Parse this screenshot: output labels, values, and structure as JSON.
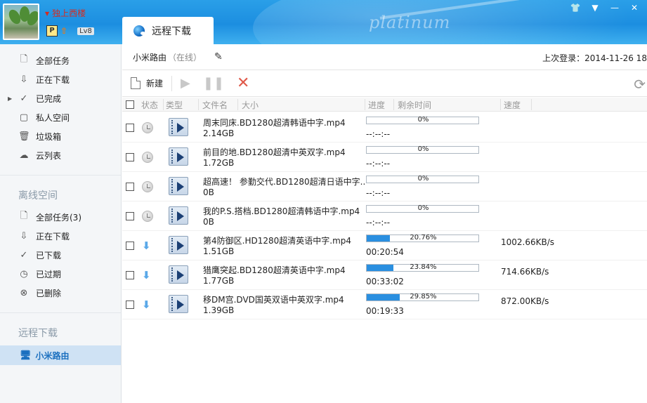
{
  "header": {
    "username": "独上西楼",
    "level": "Lv8",
    "vip": "P",
    "watermark": "platinum",
    "tab_label": "远程下载"
  },
  "sidebar": {
    "group1": [
      {
        "label": "全部任务",
        "icon": "doc-icon"
      },
      {
        "label": "正在下载",
        "icon": "download-arrow-icon"
      },
      {
        "label": "已完成",
        "icon": "check-icon"
      },
      {
        "label": "私人空间",
        "icon": "private-space-icon"
      },
      {
        "label": "垃圾箱",
        "icon": "trash-icon"
      },
      {
        "label": "云列表",
        "icon": "cloud-icon"
      }
    ],
    "offline_title": "离线空间",
    "group2": [
      {
        "label": "全部任务(3)",
        "icon": "doc-icon"
      },
      {
        "label": "正在下载",
        "icon": "download-arrow-icon"
      },
      {
        "label": "已下载",
        "icon": "check-icon"
      },
      {
        "label": "已过期",
        "icon": "clock-icon"
      },
      {
        "label": "已删除",
        "icon": "x-circle-icon"
      }
    ],
    "remote_title": "远程下载",
    "active_item": "小米路由"
  },
  "device": {
    "name": "小米路由",
    "status": "（在线）",
    "last_login": "上次登录：2014-11-26 18:"
  },
  "toolbar": {
    "new_label": "新建"
  },
  "columns": {
    "status": "状态",
    "type": "类型",
    "filename": "文件名",
    "size": "大小",
    "progress": "进度",
    "remaining": "剩余时间",
    "speed": "速度"
  },
  "tasks": [
    {
      "name": "周末同床.BD1280超清韩语中字.mp4",
      "size": "2.14GB",
      "progress_text": "0%",
      "progress": 0,
      "remaining": "--:--:--",
      "speed": "",
      "state": "waiting"
    },
    {
      "name": "前目的地.BD1280超清中英双字.mp4",
      "size": "1.72GB",
      "progress_text": "0%",
      "progress": 0,
      "remaining": "--:--:--",
      "speed": "",
      "state": "waiting"
    },
    {
      "name": "超高速！ 参勤交代.BD1280超清日语中字...",
      "size": "0B",
      "progress_text": "0%",
      "progress": 0,
      "remaining": "--:--:--",
      "speed": "",
      "state": "waiting"
    },
    {
      "name": "我的P.S.搭档.BD1280超清韩语中字.mp4",
      "size": "0B",
      "progress_text": "0%",
      "progress": 0,
      "remaining": "--:--:--",
      "speed": "",
      "state": "waiting"
    },
    {
      "name": "第4防御区.HD1280超清英语中字.mp4",
      "size": "1.51GB",
      "progress_text": "20.76%",
      "progress": 20.76,
      "remaining": "00:20:54",
      "speed": "1002.66KB/s",
      "state": "downloading"
    },
    {
      "name": "猎鹰突起.BD1280超清英语中字.mp4",
      "size": "1.77GB",
      "progress_text": "23.84%",
      "progress": 23.84,
      "remaining": "00:33:02",
      "speed": "714.66KB/s",
      "state": "downloading"
    },
    {
      "name": "移DM宫.DVD国英双语中英双字.mp4",
      "size": "1.39GB",
      "progress_text": "29.85%",
      "progress": 29.85,
      "remaining": "00:19:33",
      "speed": "872.00KB/s",
      "state": "downloading"
    }
  ]
}
